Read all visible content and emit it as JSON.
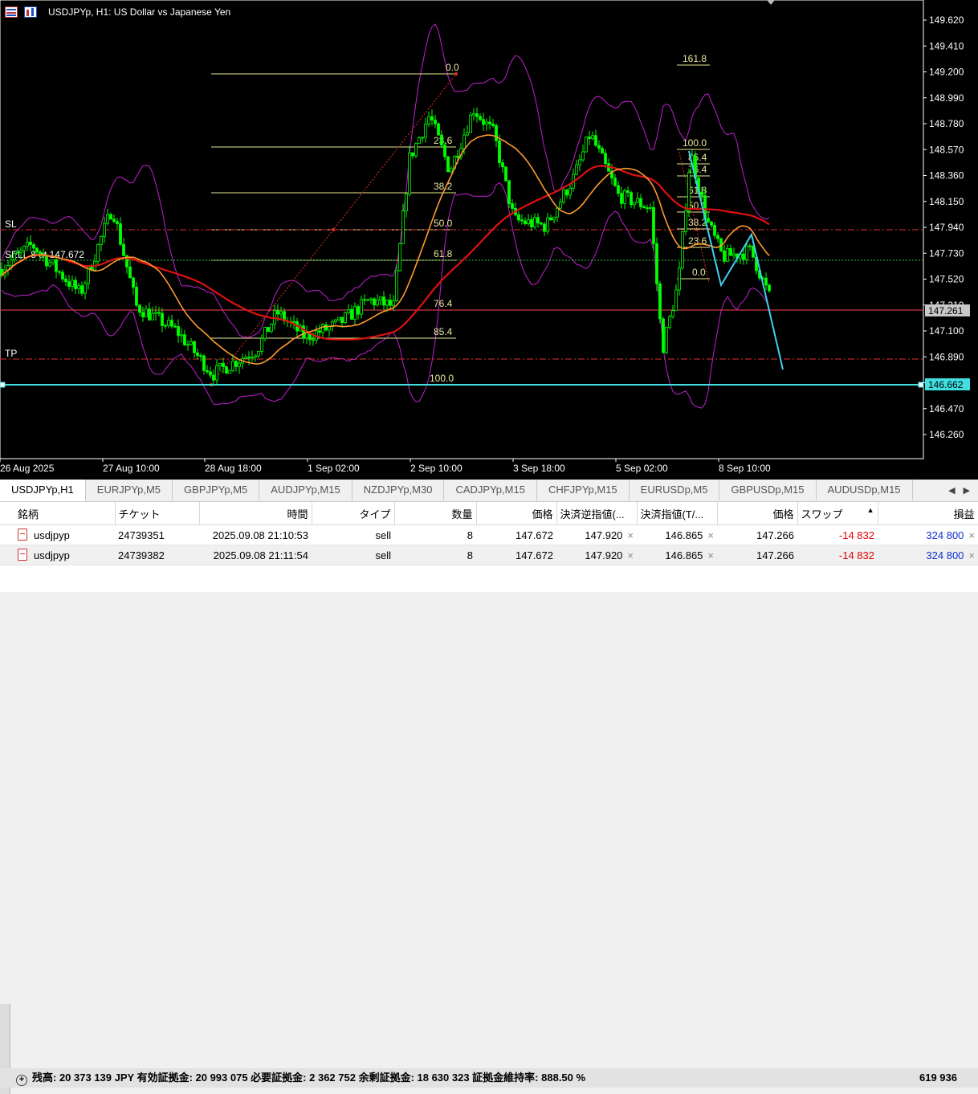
{
  "window": {
    "title": "USDJPYp, H1:  US Dollar vs Japanese Yen"
  },
  "chart": {
    "price_ticks": [
      "149.620",
      "149.410",
      "149.200",
      "148.990",
      "148.780",
      "148.570",
      "148.360",
      "148.150",
      "147.940",
      "147.730",
      "147.520",
      "147.310",
      "147.100",
      "146.890",
      "146.680",
      "146.470",
      "146.260"
    ],
    "time_ticks": [
      "26 Aug 2025",
      "27 Aug 10:00",
      "28 Aug 18:00",
      "1 Sep 02:00",
      "2 Sep 10:00",
      "3 Sep 18:00",
      "5 Sep 02:00",
      "8 Sep 10:00"
    ],
    "price_badges": {
      "current": "147.261",
      "line": "146.662"
    },
    "labels": {
      "sl": "SL",
      "tp": "TP",
      "sell_line": "SELL 8 at 147.672"
    },
    "fib_left": [
      "0.0",
      "23.6",
      "38.2",
      "50.0",
      "61.8",
      "76.4",
      "85.4",
      "100.0"
    ],
    "fib_right": [
      "161.8",
      "100.0",
      "85.4",
      "76.4",
      "61.8",
      "50.0",
      "38.2",
      "23.6",
      "0.0"
    ],
    "colors": {
      "bull": "#00ff00",
      "bear": "#00ff00",
      "ma_fast": "#ff9a2e",
      "ma_slow": "#e01010",
      "bands": "#c020d0",
      "fib": "#e8e890",
      "zigzag": "#40d0f0",
      "level_line": "#40e0e0",
      "bid_line": "#ff4050"
    }
  },
  "tabs": [
    "USDJPYp,H1",
    "EURJPYp,M5",
    "GBPJPYp,M5",
    "AUDJPYp,M15",
    "NZDJPYp,M30",
    "CADJPYp,M15",
    "CHFJPYp,M15",
    "EURUSDp,M5",
    "GBPUSDp,M15",
    "AUDUSDp,M15"
  ],
  "tab_arrows": {
    "left": "◀",
    "right": "▶"
  },
  "terminal": {
    "headers": {
      "symbol": "銘柄",
      "ticket": "チケット",
      "time": "時間",
      "type": "タイプ",
      "volume": "数量",
      "price": "価格",
      "sl": "決済逆指値(...",
      "tp": "決済指値(T/...",
      "cur_price": "価格",
      "swap": "スワップ",
      "sort_arrow": "▲",
      "profit": "損益"
    },
    "rows": [
      {
        "symbol": "usdjpyp",
        "ticket": "24739351",
        "time": "2025.09.08 21:10:53",
        "type": "sell",
        "volume": "8",
        "price": "147.672",
        "sl": "147.920",
        "tp": "146.865",
        "cur_price": "147.266",
        "swap": "-14 832",
        "profit": "324 800"
      },
      {
        "symbol": "usdjpyp",
        "ticket": "24739382",
        "time": "2025.09.08 21:11:54",
        "type": "sell",
        "volume": "8",
        "price": "147.672",
        "sl": "147.920",
        "tp": "146.865",
        "cur_price": "147.266",
        "swap": "-14 832",
        "profit": "324 800"
      }
    ],
    "status": "残高: 20 373 139 JPY  有効証拠金: 20 993 075  必要証拠金: 2 362 752  余剰証拠金: 18 630 323  証拠金維持率: 888.50 %",
    "status_total": "619 936",
    "close_glyph": "×",
    "plus_glyph": "+"
  }
}
